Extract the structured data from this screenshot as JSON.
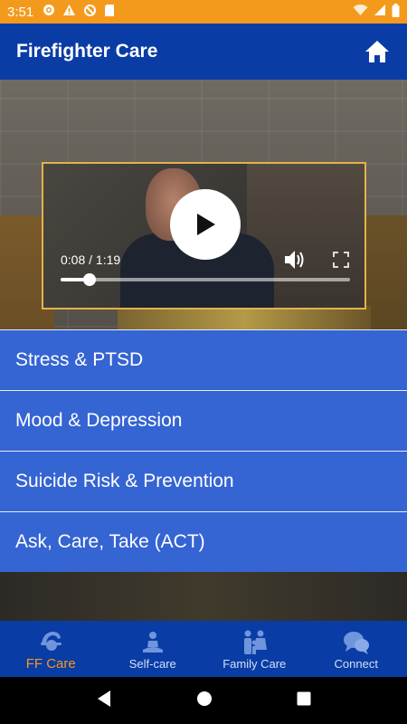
{
  "status_bar": {
    "time": "3:51",
    "icons_left": [
      "gear-icon",
      "warning-icon",
      "no-sync-icon",
      "sd-card-icon"
    ],
    "icons_right": [
      "wifi-icon",
      "signal-icon",
      "battery-icon"
    ]
  },
  "header": {
    "title": "Firefighter Care",
    "home_icon": "home-icon"
  },
  "video": {
    "time_display": "0:08 / 1:19",
    "progress_fraction": 0.1
  },
  "menu": {
    "items": [
      {
        "label": "Stress & PTSD"
      },
      {
        "label": "Mood & Depression"
      },
      {
        "label": "Suicide Risk & Prevention"
      },
      {
        "label": "Ask, Care, Take (ACT)"
      }
    ]
  },
  "tabs": [
    {
      "label": "FF Care",
      "icon": "firefighter-icon",
      "active": true
    },
    {
      "label": "Self-care",
      "icon": "meditation-icon",
      "active": false
    },
    {
      "label": "Family Care",
      "icon": "family-icon",
      "active": false
    },
    {
      "label": "Connect",
      "icon": "chat-icon",
      "active": false
    }
  ],
  "nav": {
    "back_icon": "back-icon",
    "home_icon": "nav-home-icon",
    "recents_icon": "recents-icon"
  },
  "colors": {
    "status_bar": "#f39a1c",
    "primary": "#0a3ca6",
    "menu_item": "#3564d3",
    "active_tab": "#f39a1c"
  }
}
